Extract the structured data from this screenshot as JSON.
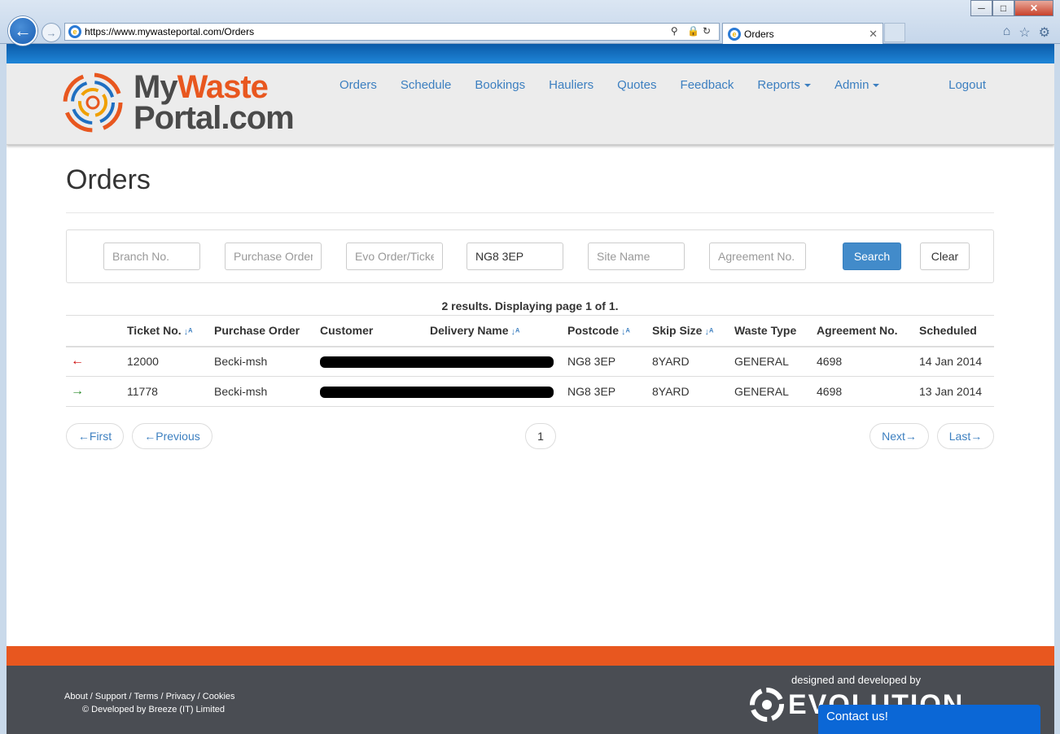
{
  "browser": {
    "url_prefix": "https://www.",
    "url_host": "mywasteportal.com",
    "url_path": "/Orders",
    "tab_title": "Orders"
  },
  "brand": {
    "line1_a": "My",
    "line1_b": "Waste",
    "line2": "Portal.com",
    "accent": "#e8571f",
    "blue": "#3c7fc0"
  },
  "nav": {
    "items": [
      "Orders",
      "Schedule",
      "Bookings",
      "Hauliers",
      "Quotes",
      "Feedback",
      "Reports",
      "Admin"
    ],
    "logout": "Logout"
  },
  "page": {
    "title": "Orders"
  },
  "filters": {
    "branch_placeholder": "Branch No.",
    "purchase_placeholder": "Purchase Order",
    "evo_placeholder": "Evo Order/Ticket",
    "postcode_value": "NG8 3EP",
    "site_placeholder": "Site Name",
    "agreement_placeholder": "Agreement No.",
    "search_label": "Search",
    "clear_label": "Clear"
  },
  "results": {
    "summary": "2 results. Displaying page 1 of 1."
  },
  "table": {
    "columns": [
      "",
      "Ticket No.",
      "Purchase Order",
      "Customer",
      "Delivery Name",
      "Postcode",
      "Skip Size",
      "Waste Type",
      "Agreement No.",
      "Scheduled"
    ],
    "rows": [
      {
        "direction_icon": "arrow-left-icon",
        "ticket": "12000",
        "purchase_order": "Becki-msh",
        "postcode": "NG8 3EP",
        "skip_size": "8YARD",
        "waste_type": "GENERAL",
        "agreement": "4698",
        "scheduled": "14 Jan 2014"
      },
      {
        "direction_icon": "arrow-right-icon",
        "ticket": "11778",
        "purchase_order": "Becki-msh",
        "postcode": "NG8 3EP",
        "skip_size": "8YARD",
        "waste_type": "GENERAL",
        "agreement": "4698",
        "scheduled": "13 Jan 2014"
      }
    ]
  },
  "pager": {
    "first": "←First",
    "previous": "←Previous",
    "page": "1",
    "next": "Next→",
    "last": "Last→"
  },
  "footer": {
    "links": [
      "About",
      "Support",
      "Terms",
      "Privacy",
      "Cookies"
    ],
    "copyright": "© Developed by Breeze (IT) Limited",
    "designed_by": "designed and developed by",
    "evo_text": "EVOLUTION",
    "contact": "Contact us!"
  }
}
